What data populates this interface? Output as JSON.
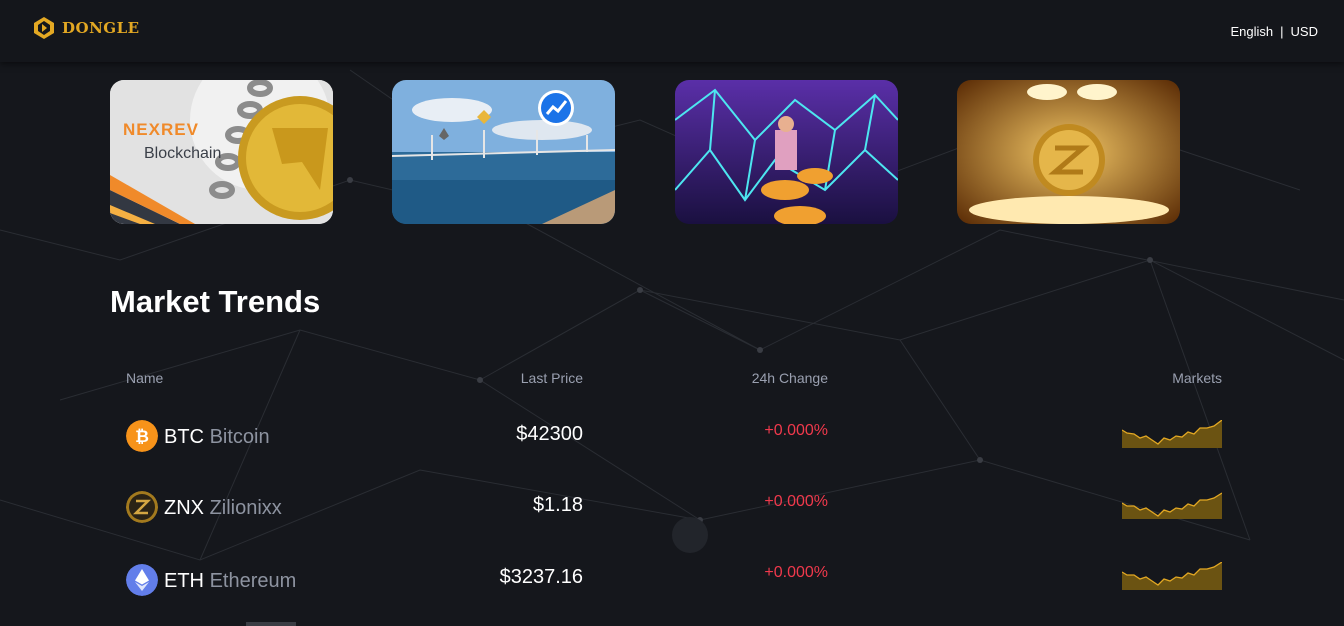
{
  "header": {
    "brand": "DONGLE",
    "language": "English",
    "separator": "|",
    "currency": "USD"
  },
  "banners": [
    {
      "name": "nexrev-banner",
      "line1": "NEXREV",
      "line2": "Blockchain"
    },
    {
      "name": "bridge-banner"
    },
    {
      "name": "network-banner"
    },
    {
      "name": "gold-coin-banner"
    }
  ],
  "market": {
    "title": "Market Trends",
    "columns": {
      "name": "Name",
      "last_price": "Last Price",
      "change": "24h Change",
      "markets": "Markets"
    },
    "rows": [
      {
        "symbol": "BTC",
        "name": "Bitcoin",
        "price": "$42300",
        "change": "+0.000%",
        "icon": "bitcoin-icon"
      },
      {
        "symbol": "ZNX",
        "name": "Zilionixx",
        "price": "$1.18",
        "change": "+0.000%",
        "icon": "zilionixx-icon"
      },
      {
        "symbol": "ETH",
        "name": "Ethereum",
        "price": "$3237.16",
        "change": "+0.000%",
        "icon": "ethereum-icon"
      }
    ]
  },
  "colors": {
    "brand": "#e3a823",
    "negative": "#f0394c",
    "background": "#15171c"
  }
}
